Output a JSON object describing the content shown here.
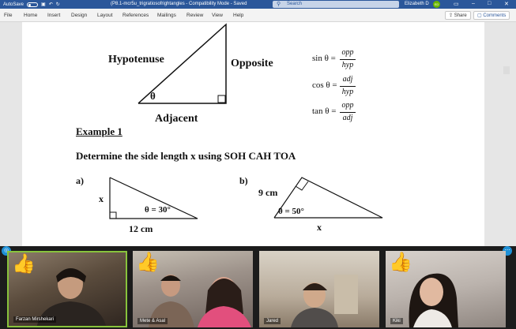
{
  "titlebar": {
    "autosave_label": "AutoSave",
    "autosave_state": "Off",
    "doc_title": "(P8.1-mcr5u_trigratiosofrightangles  -  Compatibility Mode  -  Saved",
    "search_placeholder": "Search",
    "user_name": "Elizabeth D",
    "user_initials": "ED"
  },
  "menu": {
    "items": [
      "File",
      "Home",
      "Insert",
      "Design",
      "Layout",
      "References",
      "Mailings",
      "Review",
      "View",
      "Help"
    ],
    "share_label": "Share",
    "comments_label": "Comments"
  },
  "document": {
    "hypotenuse": "Hypotenuse",
    "opposite": "Opposite",
    "adjacent": "Adjacent",
    "theta": "θ",
    "sin_lhs": "sin θ =",
    "cos_lhs": "cos θ =",
    "tan_lhs": "tan θ =",
    "opp": "opp",
    "hyp": "hyp",
    "adj": "adj",
    "example_heading": "Example 1",
    "instruction": "Determine the side length x using SOH CAH TOA",
    "part_a": "a)",
    "part_b": "b)",
    "a_side_x": "x",
    "a_angle": "θ = 30°",
    "a_base": "12 cm",
    "b_side": "9 cm",
    "b_angle": "θ = 50°",
    "b_base": "x"
  },
  "participants": [
    {
      "name": "Farzan Mirshekari",
      "reaction": "👍"
    },
    {
      "name": "Mete & Asal",
      "reaction": "👍"
    },
    {
      "name": "Jared",
      "reaction": ""
    },
    {
      "name": "Kiki",
      "reaction": "👍"
    }
  ]
}
